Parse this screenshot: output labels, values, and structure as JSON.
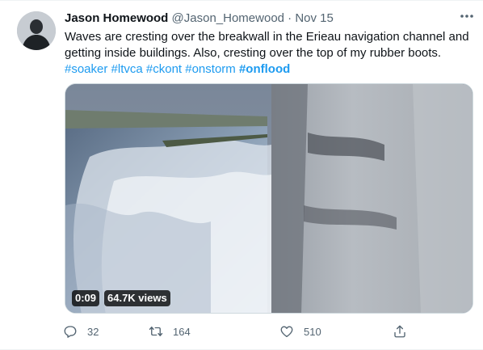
{
  "tweet": {
    "author_name": "Jason Homewood",
    "author_handle": "@Jason_Homewood",
    "separator": "·",
    "timestamp": "Nov 15",
    "text_line1": "Waves are cresting over the breakwall in the Erieau navigation channel and getting inside buildings.  Also, cresting over the top of my rubber boots.",
    "hashtags_plain": "#soaker #ltvca #ckont #onstorm ",
    "hashtag_bold": "#onflood"
  },
  "video": {
    "duration": "0:09",
    "views": "64.7K views"
  },
  "actions": {
    "replies": "32",
    "retweets": "164",
    "likes": "510"
  },
  "colors": {
    "link": "#1d9bf0",
    "secondary_text": "#536471",
    "primary_text": "#0f1419"
  },
  "icons": [
    "more-options-icon",
    "reply-icon",
    "retweet-icon",
    "like-icon",
    "share-icon"
  ]
}
